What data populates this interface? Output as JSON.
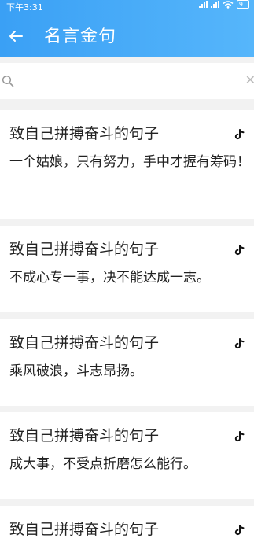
{
  "status_bar": {
    "time": "下午3:31",
    "battery": "91"
  },
  "header": {
    "title": "名言金句"
  },
  "search": {
    "placeholder": ""
  },
  "cards": [
    {
      "title": "致自己拼搏奋斗的句子",
      "text": "一个姑娘，只有努力，手中才握有筹码！"
    },
    {
      "title": "致自己拼搏奋斗的句子",
      "text": "不成心专一事，决不能达成一志。"
    },
    {
      "title": "致自己拼搏奋斗的句子",
      "text": "乘风破浪，斗志昂扬。"
    },
    {
      "title": "致自己拼搏奋斗的句子",
      "text": "成大事，不受点折磨怎么能行。"
    },
    {
      "title": "致自己拼搏奋斗的句子",
      "text": ""
    }
  ],
  "colors": {
    "header_start": "#3aa0f5",
    "header_end": "#56b6fb",
    "background": "#f2f2f2"
  },
  "icons": {
    "back": "arrow-left-icon",
    "search": "search-icon",
    "clear": "close-icon",
    "card_action": "tiktok-icon"
  }
}
